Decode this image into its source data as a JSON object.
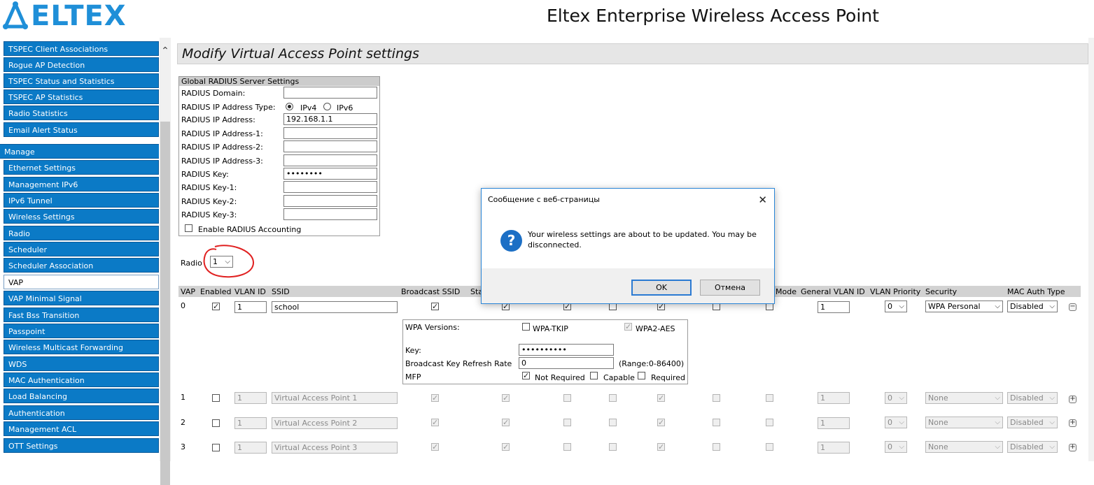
{
  "header": {
    "logo_text": "ELTEX",
    "app_title": "Eltex Enterprise Wireless Access Point"
  },
  "sidebar": {
    "items_top": [
      "TSPEC Client Associations",
      "Rogue AP Detection",
      "TSPEC Status and Statistics",
      "TSPEC AP Statistics",
      "Radio Statistics",
      "Email Alert Status"
    ],
    "section_manage": "Manage",
    "items_manage": [
      "Ethernet Settings",
      "Management IPv6",
      "IPv6 Tunnel",
      "Wireless Settings",
      "Radio",
      "Scheduler",
      "Scheduler Association",
      "VAP",
      "VAP Minimal Signal",
      "Fast Bss Transition",
      "Passpoint",
      "Wireless Multicast Forwarding",
      "WDS",
      "MAC Authentication",
      "Load Balancing",
      "Authentication",
      "Management ACL",
      "OTT Settings"
    ],
    "active_item": "VAP"
  },
  "main": {
    "page_title": "Modify Virtual Access Point settings",
    "radius": {
      "heading": "Global RADIUS Server Settings",
      "domain_label": "RADIUS Domain:",
      "domain_value": "",
      "ip_type_label": "RADIUS IP Address Type:",
      "ipv4": "IPv4",
      "ipv6": "IPv6",
      "ip_type_selected": "IPv4",
      "ip_label": "RADIUS IP Address:",
      "ip_value": "192.168.1.1",
      "ip1_label": "RADIUS IP Address-1:",
      "ip2_label": "RADIUS IP Address-2:",
      "ip3_label": "RADIUS IP Address-3:",
      "key_label": "RADIUS Key:",
      "key_value": "••••••••",
      "key1_label": "RADIUS Key-1:",
      "key2_label": "RADIUS Key-2:",
      "key3_label": "RADIUS Key-3:",
      "accounting_label": "Enable RADIUS Accounting",
      "accounting_checked": false
    },
    "radio_label": "Radio",
    "radio_value": "1",
    "vap_table": {
      "headers": [
        "VAP",
        "Enabled",
        "VLAN ID",
        "SSID",
        "Broadcast SSID",
        "Sta",
        "Mode",
        "General VLAN ID",
        "VLAN Priority",
        "Security",
        "MAC Auth Type"
      ],
      "rows": [
        {
          "vap": "0",
          "enabled": true,
          "vlan": "1",
          "ssid": "school",
          "general_vlan": "1",
          "priority": "0",
          "security": "WPA Personal",
          "mac_auth": "Disabled"
        },
        {
          "vap": "1",
          "enabled": false,
          "vlan": "1",
          "ssid": "Virtual Access Point 1",
          "general_vlan": "1",
          "priority": "0",
          "security": "None",
          "mac_auth": "Disabled"
        },
        {
          "vap": "2",
          "enabled": false,
          "vlan": "1",
          "ssid": "Virtual Access Point 2",
          "general_vlan": "1",
          "priority": "0",
          "security": "None",
          "mac_auth": "Disabled"
        },
        {
          "vap": "3",
          "enabled": false,
          "vlan": "1",
          "ssid": "Virtual Access Point 3",
          "general_vlan": "1",
          "priority": "0",
          "security": "None",
          "mac_auth": "Disabled"
        }
      ]
    },
    "wpa": {
      "versions_label": "WPA Versions:",
      "tkip_label": "WPA-TKIP",
      "aes_label": "WPA2-AES",
      "key_label": "Key:",
      "key_value": "••••••••••",
      "refresh_label": "Broadcast Key Refresh Rate",
      "refresh_value": "0",
      "refresh_range": "(Range:0-86400)",
      "mfp_label": "MFP",
      "mfp_not_required": "Not Required",
      "mfp_capable": "Capable",
      "mfp_required": "Required",
      "mfp_selected": "Not Required"
    }
  },
  "dialog": {
    "title": "Сообщение с веб-страницы",
    "message": "Your wireless settings are about to be updated. You may be disconnected.",
    "ok": "OK",
    "cancel": "Отмена",
    "icon": "question-icon"
  },
  "colors": {
    "nav_bg": "#0b7ac6",
    "brand": "#1f8fd8",
    "dialog_icon": "#1c6fc5",
    "annotation": "#e02020"
  }
}
